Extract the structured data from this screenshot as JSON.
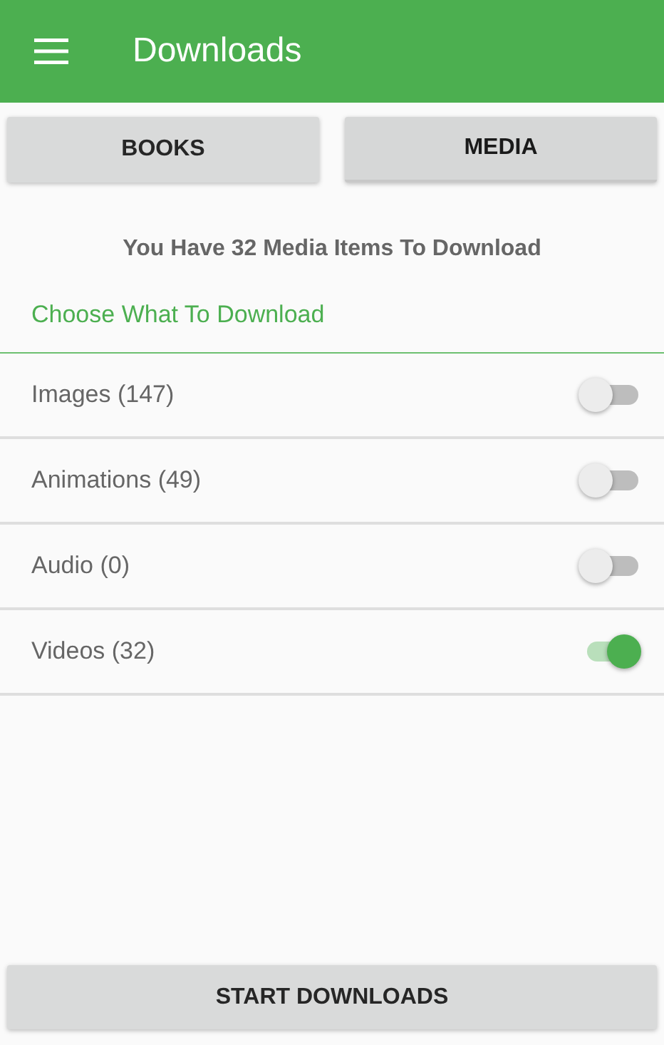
{
  "app_bar": {
    "title": "Downloads"
  },
  "tabs": [
    {
      "label": "BOOKS",
      "selected": false
    },
    {
      "label": "MEDIA",
      "selected": true
    }
  ],
  "summary": "You Have 32 Media Items To Download",
  "section_title": "Choose What To Download",
  "options": [
    {
      "label": "Images (147)",
      "on": false
    },
    {
      "label": "Animations (49)",
      "on": false
    },
    {
      "label": "Audio (0)",
      "on": false
    },
    {
      "label": "Videos (32)",
      "on": true
    }
  ],
  "action_button": "START DOWNLOADS"
}
